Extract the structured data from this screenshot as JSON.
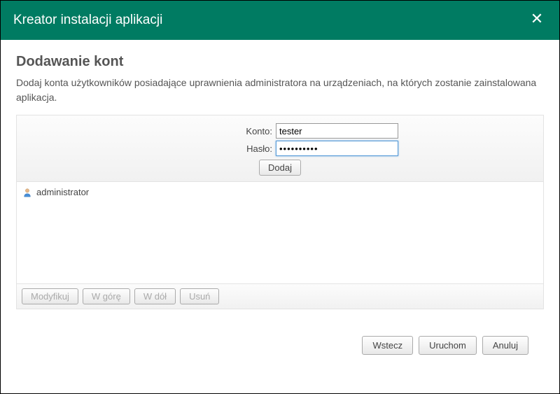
{
  "titlebar": {
    "title": "Kreator instalacji aplikacji"
  },
  "page": {
    "heading": "Dodawanie kont",
    "description": "Dodaj konta użytkowników posiadające uprawnienia administratora na urządzeniach, na których zostanie zainstalowana aplikacja."
  },
  "form": {
    "account_label": "Konto:",
    "password_label": "Hasło:",
    "account_value": "tester",
    "password_value": "••••••••••",
    "add_label": "Dodaj"
  },
  "accounts": {
    "items": [
      {
        "name": "administrator"
      }
    ]
  },
  "list_actions": {
    "modify": "Modyfikuj",
    "up": "W górę",
    "down": "W dół",
    "delete": "Usuń"
  },
  "footer": {
    "back": "Wstecz",
    "run": "Uruchom",
    "cancel": "Anuluj"
  }
}
